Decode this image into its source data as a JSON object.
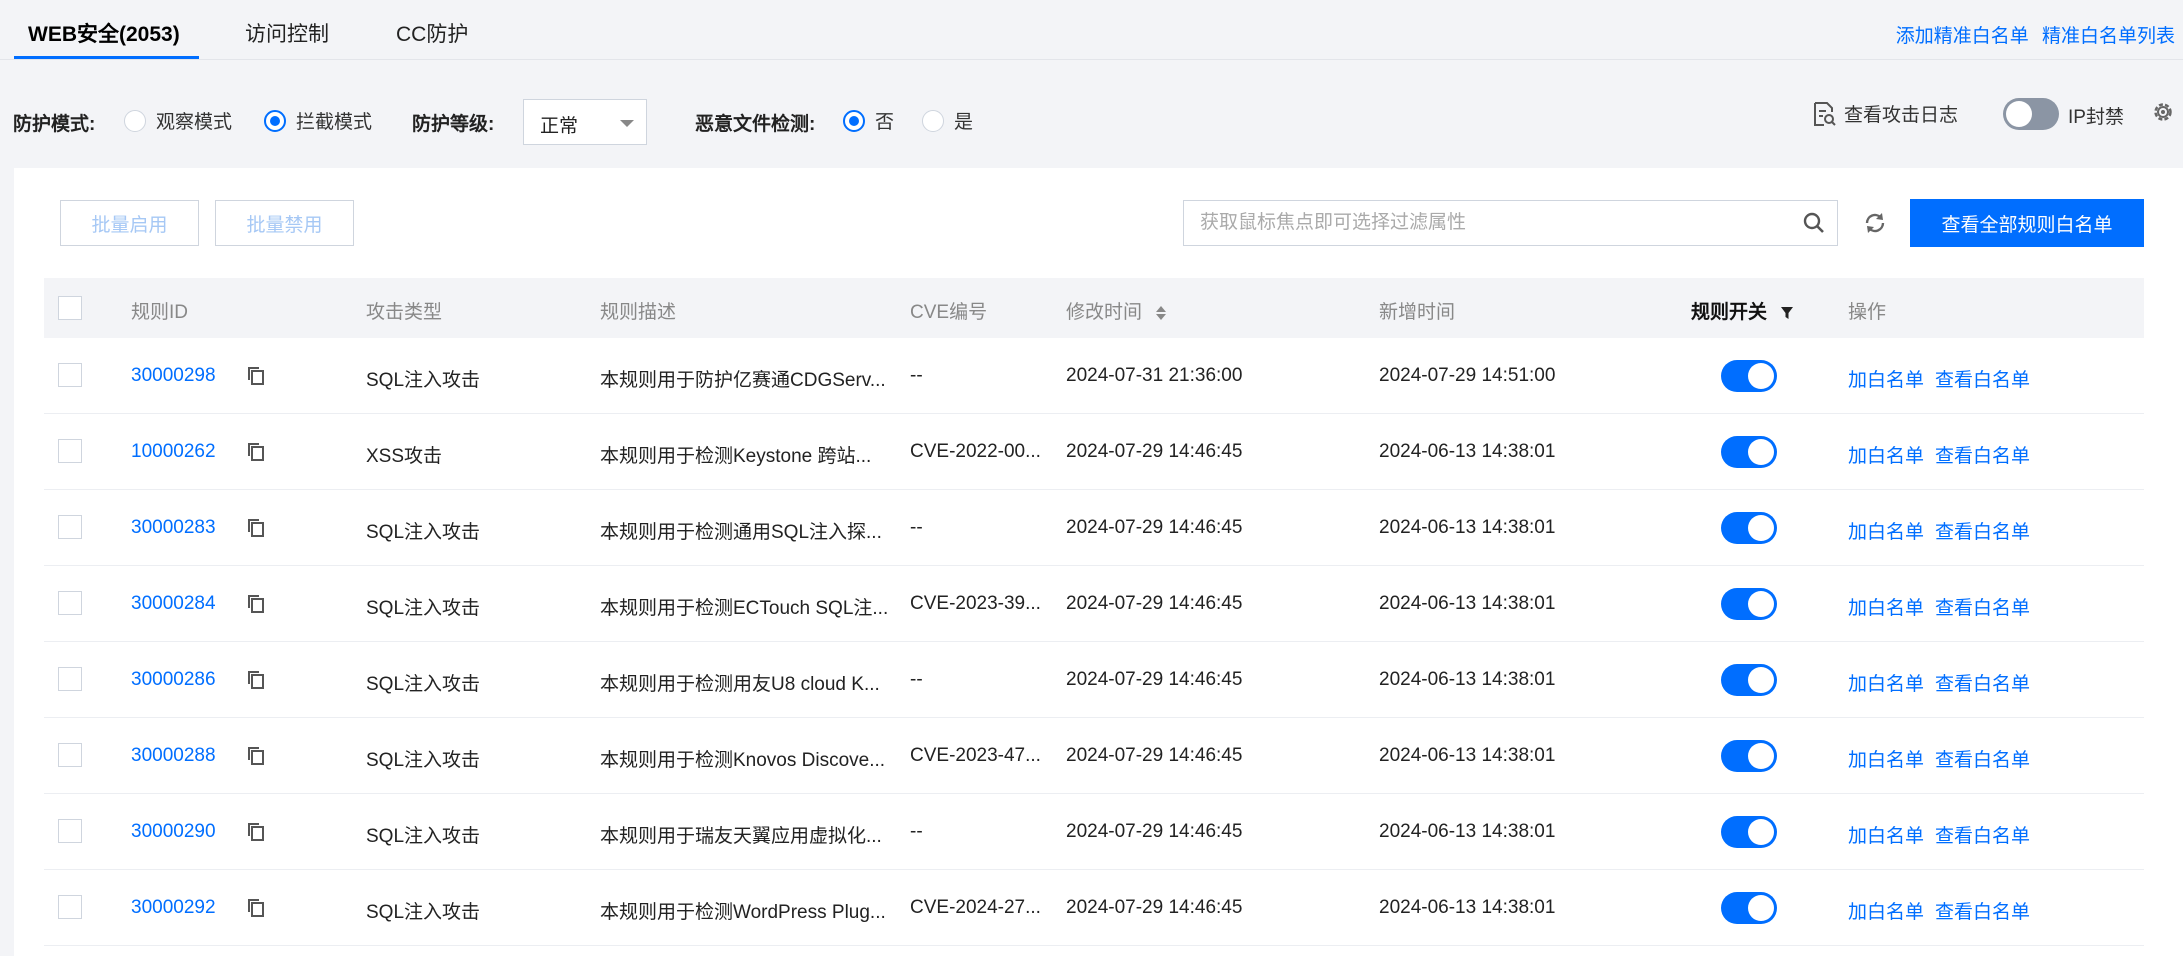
{
  "tabs": [
    {
      "label": "WEB安全(2053)",
      "active": true
    },
    {
      "label": "访问控制",
      "active": false
    },
    {
      "label": "CC防护",
      "active": false
    }
  ],
  "top_links": {
    "add": "添加精准白名单",
    "list": "精准白名单列表"
  },
  "toolbar": {
    "mode_label": "防护模式:",
    "mode_options": [
      "观察模式",
      "拦截模式"
    ],
    "mode_selected": "拦截模式",
    "level_label": "防护等级:",
    "level_value": "正常",
    "malware_label": "恶意文件检测:",
    "malware_options": [
      "否",
      "是"
    ],
    "malware_selected": "否",
    "log_link": "查看攻击日志",
    "ip_ban_label": "IP封禁"
  },
  "actions": {
    "batch_enable": "批量启用",
    "batch_disable": "批量禁用",
    "search_placeholder": "获取鼠标焦点即可选择过滤属性",
    "view_all": "查看全部规则白名单"
  },
  "columns": {
    "rule_id": "规则ID",
    "attack_type": "攻击类型",
    "desc": "规则描述",
    "cve": "CVE编号",
    "modified": "修改时间",
    "added": "新增时间",
    "switch": "规则开关",
    "ops": "操作"
  },
  "row_actions": {
    "add": "加白名单",
    "view": "查看白名单"
  },
  "rows": [
    {
      "id": "30000298",
      "type": "SQL注入攻击",
      "desc": "本规则用于防护亿赛通CDGServ...",
      "cve": "--",
      "modified": "2024-07-31 21:36:00",
      "added": "2024-07-29 14:51:00",
      "enabled": true
    },
    {
      "id": "10000262",
      "type": "XSS攻击",
      "desc": "本规则用于检测Keystone 跨站...",
      "cve": "CVE-2022-00...",
      "modified": "2024-07-29 14:46:45",
      "added": "2024-06-13 14:38:01",
      "enabled": true
    },
    {
      "id": "30000283",
      "type": "SQL注入攻击",
      "desc": "本规则用于检测通用SQL注入探...",
      "cve": "--",
      "modified": "2024-07-29 14:46:45",
      "added": "2024-06-13 14:38:01",
      "enabled": true
    },
    {
      "id": "30000284",
      "type": "SQL注入攻击",
      "desc": "本规则用于检测ECTouch SQL注...",
      "cve": "CVE-2023-39...",
      "modified": "2024-07-29 14:46:45",
      "added": "2024-06-13 14:38:01",
      "enabled": true
    },
    {
      "id": "30000286",
      "type": "SQL注入攻击",
      "desc": "本规则用于检测用友U8 cloud K...",
      "cve": "--",
      "modified": "2024-07-29 14:46:45",
      "added": "2024-06-13 14:38:01",
      "enabled": true
    },
    {
      "id": "30000288",
      "type": "SQL注入攻击",
      "desc": "本规则用于检测Knovos Discove...",
      "cve": "CVE-2023-47...",
      "modified": "2024-07-29 14:46:45",
      "added": "2024-06-13 14:38:01",
      "enabled": true
    },
    {
      "id": "30000290",
      "type": "SQL注入攻击",
      "desc": "本规则用于瑞友天翼应用虚拟化...",
      "cve": "--",
      "modified": "2024-07-29 14:46:45",
      "added": "2024-06-13 14:38:01",
      "enabled": true
    },
    {
      "id": "30000292",
      "type": "SQL注入攻击",
      "desc": "本规则用于检测WordPress Plug...",
      "cve": "CVE-2024-27...",
      "modified": "2024-07-29 14:46:45",
      "added": "2024-06-13 14:38:01",
      "enabled": true
    }
  ],
  "colors": {
    "accent": "#006eff",
    "switch_off": "#8b95a4"
  }
}
